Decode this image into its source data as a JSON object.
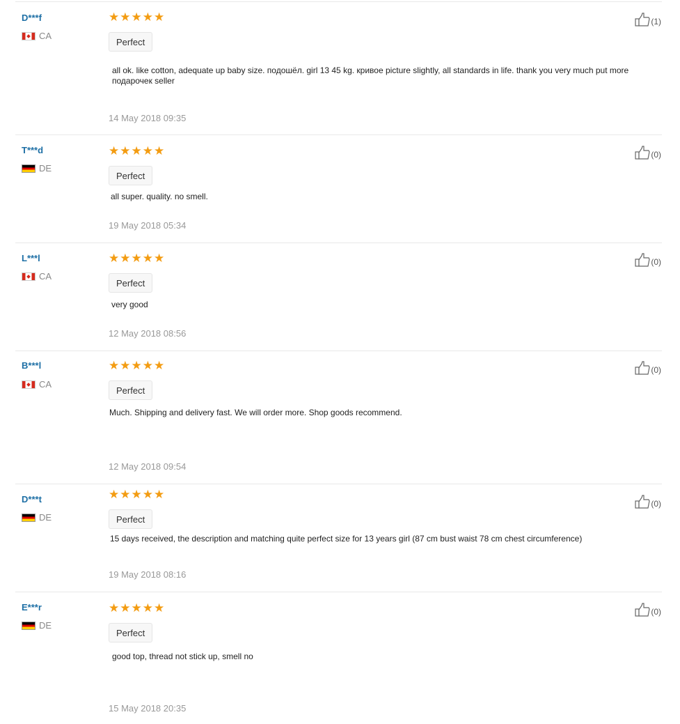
{
  "colors": {
    "star": "#f39c12",
    "username": "#1d6fa5",
    "date": "#999999"
  },
  "icons": {
    "star": "star-icon",
    "thumb": "thumbs-up-icon"
  },
  "reviews": [
    {
      "user": "D***f",
      "country": "CA",
      "flag": "canada-flag-icon",
      "rating": 5,
      "tag": "Perfect",
      "text": "all ok. like cotton, adequate up baby size. подошёл. girl 13 45 kg. кривое picture slightly, all standards in life. thank you very much put more подарочек seller",
      "date": "14 May 2018 09:35",
      "helpful": "(1)"
    },
    {
      "user": "T***d",
      "country": "DE",
      "flag": "germany-flag-icon",
      "rating": 5,
      "tag": "Perfect",
      "text": "all super. quality. no smell.",
      "date": "19 May 2018 05:34",
      "helpful": "(0)"
    },
    {
      "user": "L***l",
      "country": "CA",
      "flag": "canada-flag-icon",
      "rating": 5,
      "tag": "Perfect",
      "text": "very good",
      "date": "12 May 2018 08:56",
      "helpful": "(0)"
    },
    {
      "user": "B***l",
      "country": "CA",
      "flag": "canada-flag-icon",
      "rating": 5,
      "tag": "Perfect",
      "text": "Much. Shipping and delivery fast. We will order more. Shop goods recommend.",
      "date": "12 May 2018 09:54",
      "helpful": "(0)"
    },
    {
      "user": "D***t",
      "country": "DE",
      "flag": "germany-flag-icon",
      "rating": 5,
      "tag": "Perfect",
      "text": "15 days received, the description and matching quite perfect size for 13 years girl (87 cm bust waist 78 cm chest circumference)",
      "date": "19 May 2018 08:16",
      "helpful": "(0)"
    },
    {
      "user": "E***r",
      "country": "DE",
      "flag": "germany-flag-icon",
      "rating": 5,
      "tag": "Perfect",
      "text": "good top, thread not stick up, smell no",
      "date": "15 May 2018 20:35",
      "helpful": "(0)"
    }
  ]
}
